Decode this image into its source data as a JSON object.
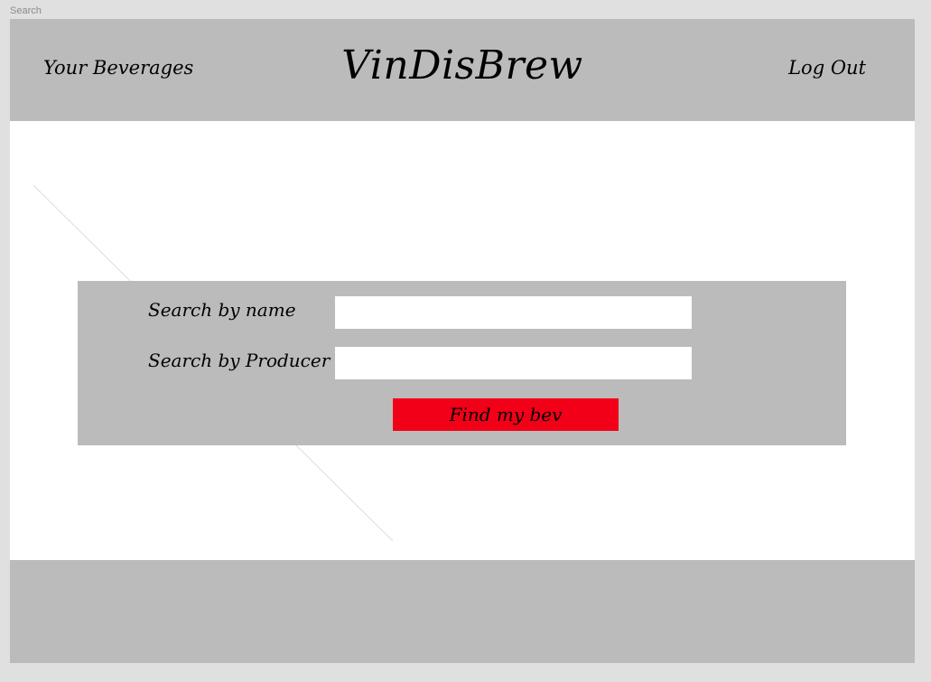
{
  "frame": {
    "label": "Search"
  },
  "header": {
    "nav_left_label": "Your Beverages",
    "brand": "VinDisBrew",
    "nav_right_label": "Log Out"
  },
  "search_form": {
    "name_label": "Search by name",
    "name_value": "",
    "producer_label": "Search by Producer",
    "producer_value": "",
    "submit_label": "Find my bev"
  },
  "colors": {
    "bar_gray": "#bbbbbb",
    "canvas": "#e0e0e0",
    "submit_red": "#f20017"
  }
}
